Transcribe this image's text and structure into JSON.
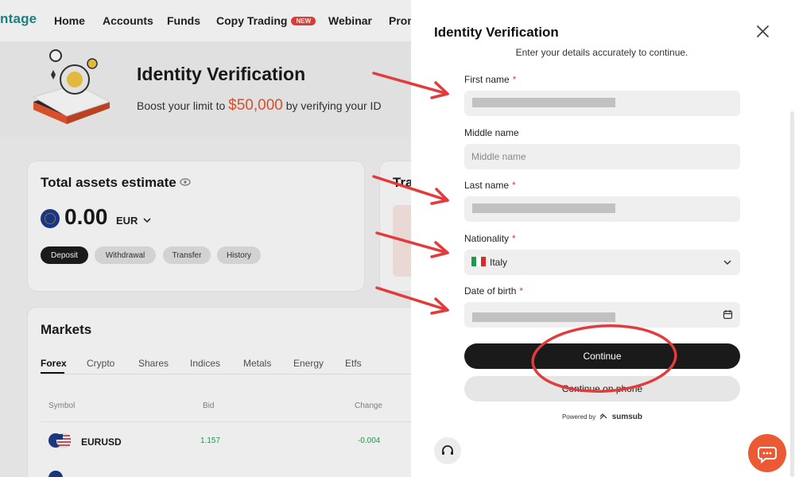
{
  "nav": {
    "logo_text": "ntage",
    "items": [
      {
        "label": "Home"
      },
      {
        "label": "Accounts"
      },
      {
        "label": "Funds"
      },
      {
        "label": "Copy Trading",
        "badge": "NEW"
      },
      {
        "label": "Webinar"
      },
      {
        "label": "Prom"
      }
    ]
  },
  "hero": {
    "title": "Identity Verification",
    "subtitle_prefix": "Boost your limit to",
    "amount": "$50,000",
    "subtitle_suffix": "by verifying your ID"
  },
  "assets": {
    "title": "Total assets estimate",
    "balance": "0.00",
    "currency": "EUR",
    "actions": [
      "Deposit",
      "Withdrawal",
      "Transfer",
      "History"
    ],
    "side_card_title": "Tra"
  },
  "markets": {
    "title": "Markets",
    "tabs": [
      "Forex",
      "Crypto",
      "Shares",
      "Indices",
      "Metals",
      "Energy",
      "Etfs"
    ],
    "active_tab": "Forex",
    "columns": [
      "Symbol",
      "Bid",
      "Change"
    ],
    "rows": [
      {
        "symbol": "EURUSD",
        "bid": "1.157",
        "change": "-0.004"
      }
    ]
  },
  "modal": {
    "title": "Identity Verification",
    "subtitle": "Enter your details accurately to continue.",
    "fields": {
      "first_name": {
        "label": "First name",
        "required": "*"
      },
      "middle_name": {
        "label": "Middle name",
        "placeholder": "Middle name"
      },
      "last_name": {
        "label": "Last name",
        "required": "*"
      },
      "nationality": {
        "label": "Nationality",
        "required": "*",
        "value": "Italy"
      },
      "dob": {
        "label": "Date of birth",
        "required": "*"
      }
    },
    "continue_label": "Continue",
    "phone_label": "Continue on phone",
    "powered_by": "Powered by",
    "powered_brand": "sumsub"
  },
  "colors": {
    "accent_orange": "#e8552f",
    "annotation_red": "#e23b3b",
    "button_dark": "#1a1a1a",
    "brand_teal": "#1f8a8c",
    "chat_orange": "#ec5a34"
  }
}
